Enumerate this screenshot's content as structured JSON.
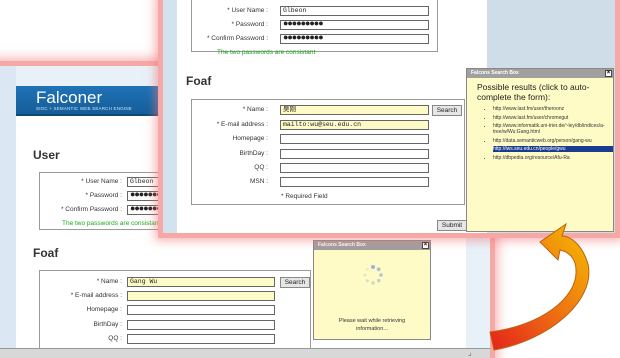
{
  "back": {
    "header_title": "Falconer",
    "header_subtitle": "SIOC + SEMANTIC WEB SEARCH ENGINE",
    "user_section": "User",
    "user": {
      "username_label": "* User Name :",
      "username_value": "Glbeon",
      "password_label": "* Password :",
      "password_value": "●●●●●●●●●",
      "confirm_label": "* Confirm Password :",
      "confirm_value": "●●●●●●●●●",
      "consistent_msg": "The two passwords are consistant"
    },
    "foaf_section": "Foaf",
    "foaf": {
      "name_label": "* Name :",
      "name_value": "Gang Wu",
      "search_btn": "Search",
      "email_label": "* E-mail address :",
      "homepage_label": "Homepage :",
      "birthday_label": "BirthDay :",
      "qq_label": "QQ :"
    }
  },
  "front": {
    "user": {
      "username_label": "* User Name :",
      "username_value": "Glbeon",
      "password_label": "* Password :",
      "password_value": "●●●●●●●●●",
      "confirm_label": "* Confirm Password :",
      "confirm_value": "●●●●●●●●●",
      "consistent_msg": "The two passwords are consistant"
    },
    "foaf_section": "Foaf",
    "foaf": {
      "name_label": "* Name :",
      "name_value": "吴刚",
      "search_btn": "Search",
      "email_label": "* E-mail address :",
      "email_value": "mailto:wu@seu.edu.cn",
      "homepage_label": "Homepage :",
      "birthday_label": "BirthDay :",
      "qq_label": "QQ :",
      "msn_label": "MSN :",
      "required_note": "* Required Field",
      "submit_btn": "Submit"
    }
  },
  "popup_loading": {
    "title": "Falcons Search Box",
    "close": "×",
    "message_line1": "Please wait while retrieving",
    "message_line2": "information..."
  },
  "popup_results": {
    "title": "Falcons Search Box",
    "close": "×",
    "heading": "Possible results (click to auto-complete the form):",
    "results": [
      "http://www.last.fm/user/theroonz",
      "http://www.last.fm/user/chromegut",
      "http://www.informatik.uni-trier.de/~ley/db/indices/a-tree/w/Wu:Gang.html",
      "http://data.semanticweb.org/person/gang-wu",
      "http://iws.seu.edu.cn/people/gwu",
      "http://dbpedia.org/resource/Afu-Ra"
    ],
    "selected_index": 4
  },
  "colors": {
    "header_blue": "#1f73b8",
    "ok_green": "#1ea51e",
    "highlight_yellow": "#fffbc6",
    "selection_blue": "#1a3c8f",
    "arrow_red": "#e4221b",
    "arrow_yellow": "#f2c000"
  }
}
